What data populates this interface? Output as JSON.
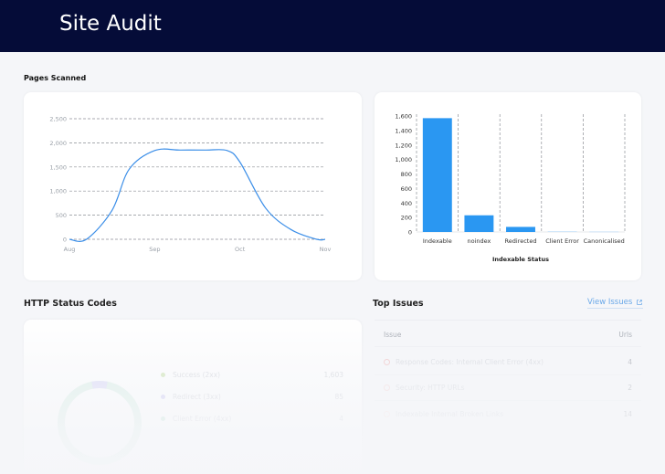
{
  "header": {
    "title": "Site Audit"
  },
  "pages_scanned": {
    "label": "Pages Scanned",
    "chart_data": {
      "type": "area",
      "x_tick_labels": [
        "Aug",
        "Sep",
        "Oct",
        "Nov"
      ],
      "y_tick_labels": [
        "0",
        "500",
        "1,000",
        "1,500",
        "2,000",
        "2,500"
      ],
      "ylim": [
        0,
        2500
      ],
      "x": [
        0,
        0.2,
        0.5,
        0.7,
        1.0,
        1.3,
        1.6,
        1.85,
        2.0,
        2.3,
        2.6,
        2.9,
        3.0
      ],
      "values": [
        0,
        0,
        600,
        1450,
        1840,
        1850,
        1850,
        1840,
        1600,
        650,
        200,
        0,
        0
      ],
      "color": "#3b8ee8",
      "grid": "dashed-horizontal"
    }
  },
  "indexable": {
    "chart_data": {
      "type": "bar",
      "categories": [
        "Indexable",
        "noindex",
        "Redirected",
        "Client Error",
        "Canonicalised"
      ],
      "values": [
        1570,
        230,
        70,
        8,
        5
      ],
      "xlabel": "Indexable Status",
      "ylim": [
        0,
        1600
      ],
      "y_tick_labels": [
        "0",
        "200",
        "400",
        "600",
        "800",
        "1,000",
        "1,200",
        "1,400",
        "1,600"
      ],
      "color": "#2a97f2",
      "grid": "dashed-vertical"
    }
  },
  "http_status": {
    "label": "HTTP Status Codes",
    "legend": [
      {
        "label": "Success (2xx)",
        "value": "1,603",
        "color": "#b4d59a"
      },
      {
        "label": "Redirect (3xx)",
        "value": "85",
        "color": "#b9b6ef"
      },
      {
        "label": "Client Error (4xx)",
        "value": "4",
        "color": "#a9dcc4"
      }
    ]
  },
  "top_issues": {
    "label": "Top Issues",
    "view_link": "View Issues",
    "col_issue": "Issue",
    "col_urls": "Urls",
    "rows": [
      {
        "text": "Response Codes: Internal Client Error (4xx)",
        "count": "4"
      },
      {
        "text": "Security: HTTP URLs",
        "count": "2"
      },
      {
        "text": "Indexable Internal Broken Links",
        "count": "14"
      }
    ]
  },
  "colors": {
    "header_bg": "#050c38",
    "accent": "#2a97f2",
    "link": "#6aa8e8"
  }
}
